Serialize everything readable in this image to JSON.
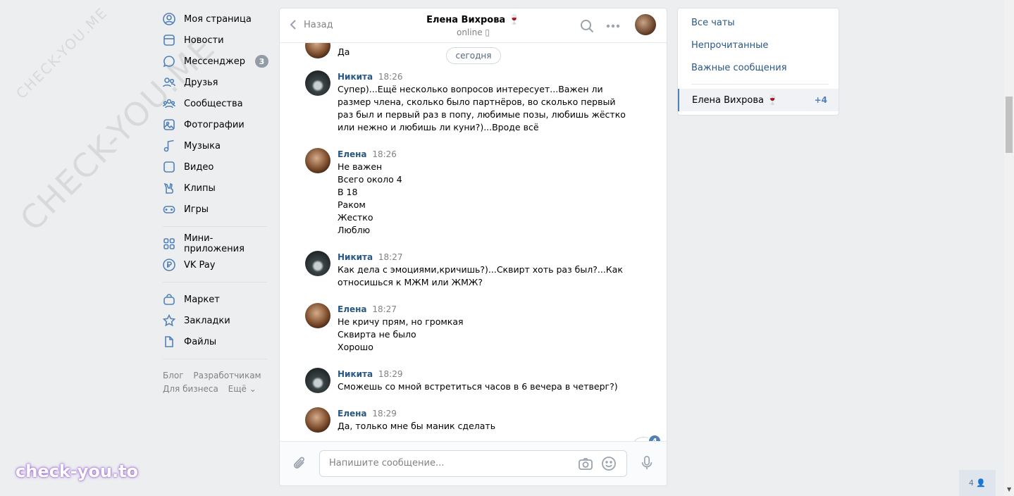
{
  "watermark": {
    "diagonal_large": "CHECK-YOU.ME",
    "diagonal_small": "CHECK-YOU.ME",
    "bottom": "check-you.to"
  },
  "nav": {
    "items": [
      {
        "label": "Моя страница",
        "icon": "user-circle-icon"
      },
      {
        "label": "Новости",
        "icon": "newspaper-icon"
      },
      {
        "label": "Мессенджер",
        "icon": "message-icon",
        "badge": "3"
      },
      {
        "label": "Друзья",
        "icon": "friends-icon"
      },
      {
        "label": "Сообщества",
        "icon": "groups-icon"
      },
      {
        "label": "Фотографии",
        "icon": "photo-icon"
      },
      {
        "label": "Музыка",
        "icon": "music-icon"
      },
      {
        "label": "Видео",
        "icon": "video-icon"
      },
      {
        "label": "Клипы",
        "icon": "clips-icon"
      },
      {
        "label": "Игры",
        "icon": "gamepad-icon"
      },
      {
        "label": "Мини-приложения",
        "icon": "apps-icon"
      },
      {
        "label": "VK Pay",
        "icon": "vkpay-icon"
      },
      {
        "label": "Маркет",
        "icon": "bag-icon"
      },
      {
        "label": "Закладки",
        "icon": "star-icon"
      },
      {
        "label": "Файлы",
        "icon": "file-icon"
      }
    ],
    "footer": {
      "blog": "Блог",
      "developers": "Разработчикам",
      "business": "Для бизнеса",
      "more": "Ещё ⌄"
    }
  },
  "chat": {
    "back_label": "Назад",
    "peer_name": "Елена Вихрова 🍷",
    "peer_status": "online ▯",
    "date_divider": "сегодня",
    "first_fragment": "Да",
    "messages": [
      {
        "author": "Никита",
        "time": "18:26",
        "avatar": "nik",
        "lines": [
          "Супер)...Ещё несколько вопросов интересует...Важен ли",
          "размер члена, сколько было партнёров, во сколько первый",
          "раз был и первый раз в попу, любимые позы, любишь жёстко",
          "или нежно и любишь ли куни?)...Вроде всё"
        ]
      },
      {
        "author": "Елена",
        "time": "18:26",
        "avatar": "ele",
        "lines": [
          "Не важен",
          "Всего около 4",
          "В 18",
          "Раком",
          "Жестко",
          "Люблю"
        ]
      },
      {
        "author": "Никита",
        "time": "18:27",
        "avatar": "nik",
        "lines": [
          "Как дела с эмоциями,кричишь?)...Сквирт хоть раз был?...Как",
          "относишься к МЖМ или ЖМЖ?"
        ]
      },
      {
        "author": "Елена",
        "time": "18:27",
        "avatar": "ele",
        "lines": [
          "Не кричу прям, но громкая",
          "Сквирта не было",
          "Хорошо"
        ]
      },
      {
        "author": "Никита",
        "time": "18:29",
        "avatar": "nik",
        "lines": [
          "Сможешь со мной встретиться часов в 6 вечера в четверг?)"
        ]
      },
      {
        "author": "Елена",
        "time": "18:29",
        "avatar": "ele",
        "lines": [
          "Да, только мне бы маник сделать"
        ]
      }
    ],
    "unread_badge": "4",
    "composer_placeholder": "Напишите сообщение..."
  },
  "filters": {
    "all": "Все чаты",
    "unread": "Непрочитанные",
    "important": "Важные сообщения",
    "active_chat": "Елена Вихрова 🍷",
    "active_count": "+4"
  },
  "online_counter": "4 👤",
  "colors": {
    "accent": "#5181b8",
    "link": "#2a5885",
    "background": "#edeef0"
  }
}
